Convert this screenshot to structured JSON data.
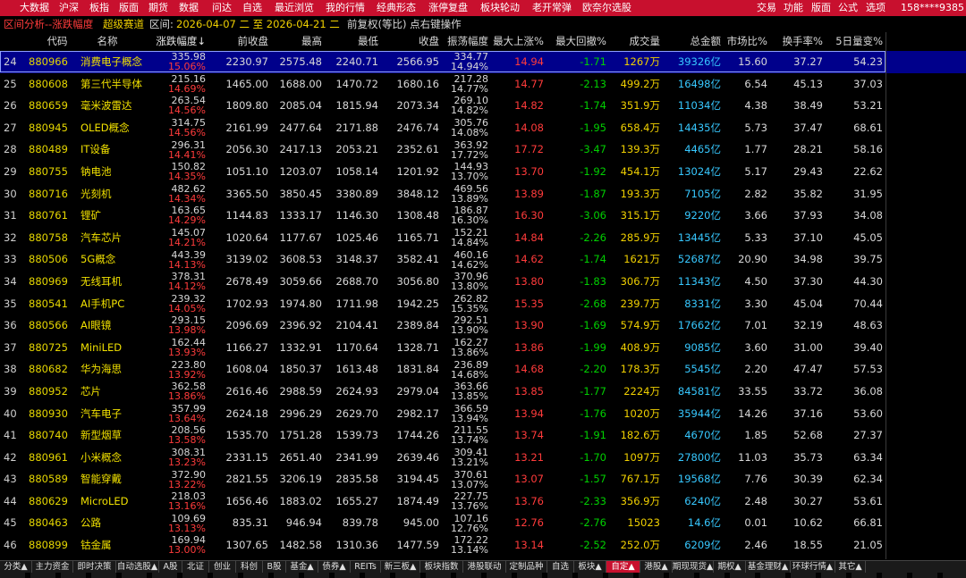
{
  "menubar": {
    "left": [
      "大数据",
      "沪深",
      "板指",
      "版面",
      "期货",
      "数据",
      "问达",
      "自选",
      "最近浏览",
      "我的行情",
      "经典形态",
      "涨停复盘",
      "板块轮动",
      "老开常弹",
      "欧奈尔选股"
    ],
    "right": [
      "交易",
      "功能",
      "版面",
      "公式",
      "选项"
    ],
    "account": "158****9385"
  },
  "infobar": {
    "title": "区间分析--涨跌幅度",
    "track": "超级赛道",
    "range_label": "区间:",
    "range": "2026-04-07 二 至 2026-04-21 二",
    "mode": "前复权(等比) 点右键操作"
  },
  "columns": [
    "代码",
    "名称",
    "涨跌幅度↓",
    "前收盘",
    "最高",
    "最低",
    "收盘",
    "振荡幅度",
    "最大上涨%",
    "最大回撤%",
    "成交量",
    "总金额",
    "市场比%",
    "换手率%",
    "5日量变%"
  ],
  "rows": [
    {
      "idx": "24",
      "code": "880966",
      "name": "消费电子概念",
      "chg": "335.98",
      "chg_pct": "15.06%",
      "prev": "2230.97",
      "high": "2575.48",
      "low": "2240.71",
      "close": "2566.95",
      "amp": "334.77",
      "amp_pct": "14.94%",
      "maxup": "14.94",
      "maxdd": "-1.71",
      "vol": "1267万",
      "amt": "39326亿",
      "mkt": "15.60",
      "turn": "37.27",
      "v5": "54.23"
    },
    {
      "idx": "25",
      "code": "880608",
      "name": "第三代半导体",
      "chg": "215.16",
      "chg_pct": "14.69%",
      "prev": "1465.00",
      "high": "1688.00",
      "low": "1470.72",
      "close": "1680.16",
      "amp": "217.28",
      "amp_pct": "14.77%",
      "maxup": "14.77",
      "maxdd": "-2.13",
      "vol": "499.2万",
      "amt": "16498亿",
      "mkt": "6.54",
      "turn": "45.13",
      "v5": "37.03"
    },
    {
      "idx": "26",
      "code": "880659",
      "name": "毫米波雷达",
      "chg": "263.54",
      "chg_pct": "14.56%",
      "prev": "1809.80",
      "high": "2085.04",
      "low": "1815.94",
      "close": "2073.34",
      "amp": "269.10",
      "amp_pct": "14.82%",
      "maxup": "14.82",
      "maxdd": "-1.74",
      "vol": "351.9万",
      "amt": "11034亿",
      "mkt": "4.38",
      "turn": "38.49",
      "v5": "53.21"
    },
    {
      "idx": "27",
      "code": "880945",
      "name": "OLED概念",
      "chg": "314.75",
      "chg_pct": "14.56%",
      "prev": "2161.99",
      "high": "2477.64",
      "low": "2171.88",
      "close": "2476.74",
      "amp": "305.76",
      "amp_pct": "14.08%",
      "maxup": "14.08",
      "maxdd": "-1.95",
      "vol": "658.4万",
      "amt": "14435亿",
      "mkt": "5.73",
      "turn": "37.47",
      "v5": "68.61"
    },
    {
      "idx": "28",
      "code": "880489",
      "name": "IT设备",
      "chg": "296.31",
      "chg_pct": "14.41%",
      "prev": "2056.30",
      "high": "2417.13",
      "low": "2053.21",
      "close": "2352.61",
      "amp": "363.92",
      "amp_pct": "17.72%",
      "maxup": "17.72",
      "maxdd": "-3.47",
      "vol": "139.3万",
      "amt": "4465亿",
      "mkt": "1.77",
      "turn": "28.21",
      "v5": "58.16"
    },
    {
      "idx": "29",
      "code": "880755",
      "name": "钠电池",
      "chg": "150.82",
      "chg_pct": "14.35%",
      "prev": "1051.10",
      "high": "1203.07",
      "low": "1058.14",
      "close": "1201.92",
      "amp": "144.93",
      "amp_pct": "13.70%",
      "maxup": "13.70",
      "maxdd": "-1.92",
      "vol": "454.1万",
      "amt": "13024亿",
      "mkt": "5.17",
      "turn": "29.43",
      "v5": "22.62"
    },
    {
      "idx": "30",
      "code": "880716",
      "name": "光刻机",
      "chg": "482.62",
      "chg_pct": "14.34%",
      "prev": "3365.50",
      "high": "3850.45",
      "low": "3380.89",
      "close": "3848.12",
      "amp": "469.56",
      "amp_pct": "13.89%",
      "maxup": "13.89",
      "maxdd": "-1.87",
      "vol": "193.3万",
      "amt": "7105亿",
      "mkt": "2.82",
      "turn": "35.82",
      "v5": "31.95"
    },
    {
      "idx": "31",
      "code": "880761",
      "name": "锂矿",
      "chg": "163.65",
      "chg_pct": "14.29%",
      "prev": "1144.83",
      "high": "1333.17",
      "low": "1146.30",
      "close": "1308.48",
      "amp": "186.87",
      "amp_pct": "16.30%",
      "maxup": "16.30",
      "maxdd": "-3.06",
      "vol": "315.1万",
      "amt": "9220亿",
      "mkt": "3.66",
      "turn": "37.93",
      "v5": "34.08"
    },
    {
      "idx": "32",
      "code": "880758",
      "name": "汽车芯片",
      "chg": "145.07",
      "chg_pct": "14.21%",
      "prev": "1020.64",
      "high": "1177.67",
      "low": "1025.46",
      "close": "1165.71",
      "amp": "152.21",
      "amp_pct": "14.84%",
      "maxup": "14.84",
      "maxdd": "-2.26",
      "vol": "285.9万",
      "amt": "13445亿",
      "mkt": "5.33",
      "turn": "37.10",
      "v5": "45.05"
    },
    {
      "idx": "33",
      "code": "880506",
      "name": "5G概念",
      "chg": "443.39",
      "chg_pct": "14.13%",
      "prev": "3139.02",
      "high": "3608.53",
      "low": "3148.37",
      "close": "3582.41",
      "amp": "460.16",
      "amp_pct": "14.62%",
      "maxup": "14.62",
      "maxdd": "-1.74",
      "vol": "1621万",
      "amt": "52687亿",
      "mkt": "20.90",
      "turn": "34.98",
      "v5": "39.75"
    },
    {
      "idx": "34",
      "code": "880969",
      "name": "无线耳机",
      "chg": "378.31",
      "chg_pct": "14.12%",
      "prev": "2678.49",
      "high": "3059.66",
      "low": "2688.70",
      "close": "3056.80",
      "amp": "370.96",
      "amp_pct": "13.80%",
      "maxup": "13.80",
      "maxdd": "-1.83",
      "vol": "306.7万",
      "amt": "11343亿",
      "mkt": "4.50",
      "turn": "37.30",
      "v5": "44.30"
    },
    {
      "idx": "35",
      "code": "880541",
      "name": "AI手机PC",
      "chg": "239.32",
      "chg_pct": "14.05%",
      "prev": "1702.93",
      "high": "1974.80",
      "low": "1711.98",
      "close": "1942.25",
      "amp": "262.82",
      "amp_pct": "15.35%",
      "maxup": "15.35",
      "maxdd": "-2.68",
      "vol": "239.7万",
      "amt": "8331亿",
      "mkt": "3.30",
      "turn": "45.04",
      "v5": "70.44"
    },
    {
      "idx": "36",
      "code": "880566",
      "name": "AI眼镜",
      "chg": "293.15",
      "chg_pct": "13.98%",
      "prev": "2096.69",
      "high": "2396.92",
      "low": "2104.41",
      "close": "2389.84",
      "amp": "292.51",
      "amp_pct": "13.90%",
      "maxup": "13.90",
      "maxdd": "-1.69",
      "vol": "574.9万",
      "amt": "17662亿",
      "mkt": "7.01",
      "turn": "32.19",
      "v5": "48.63"
    },
    {
      "idx": "37",
      "code": "880725",
      "name": "MiniLED",
      "chg": "162.44",
      "chg_pct": "13.93%",
      "prev": "1166.27",
      "high": "1332.91",
      "low": "1170.64",
      "close": "1328.71",
      "amp": "162.27",
      "amp_pct": "13.86%",
      "maxup": "13.86",
      "maxdd": "-1.99",
      "vol": "408.9万",
      "amt": "9085亿",
      "mkt": "3.60",
      "turn": "31.00",
      "v5": "39.40"
    },
    {
      "idx": "38",
      "code": "880682",
      "name": "华为海思",
      "chg": "223.80",
      "chg_pct": "13.92%",
      "prev": "1608.04",
      "high": "1850.37",
      "low": "1613.48",
      "close": "1831.84",
      "amp": "236.89",
      "amp_pct": "14.68%",
      "maxup": "14.68",
      "maxdd": "-2.20",
      "vol": "178.3万",
      "amt": "5545亿",
      "mkt": "2.20",
      "turn": "47.47",
      "v5": "57.53"
    },
    {
      "idx": "39",
      "code": "880952",
      "name": "芯片",
      "chg": "362.58",
      "chg_pct": "13.86%",
      "prev": "2616.46",
      "high": "2988.59",
      "low": "2624.93",
      "close": "2979.04",
      "amp": "363.66",
      "amp_pct": "13.85%",
      "maxup": "13.85",
      "maxdd": "-1.77",
      "vol": "2224万",
      "amt": "84581亿",
      "mkt": "33.55",
      "turn": "33.72",
      "v5": "36.08"
    },
    {
      "idx": "40",
      "code": "880930",
      "name": "汽车电子",
      "chg": "357.99",
      "chg_pct": "13.64%",
      "prev": "2624.18",
      "high": "2996.29",
      "low": "2629.70",
      "close": "2982.17",
      "amp": "366.59",
      "amp_pct": "13.94%",
      "maxup": "13.94",
      "maxdd": "-1.76",
      "vol": "1020万",
      "amt": "35944亿",
      "mkt": "14.26",
      "turn": "37.16",
      "v5": "53.60"
    },
    {
      "idx": "41",
      "code": "880740",
      "name": "新型烟草",
      "chg": "208.56",
      "chg_pct": "13.58%",
      "prev": "1535.70",
      "high": "1751.28",
      "low": "1539.73",
      "close": "1744.26",
      "amp": "211.55",
      "amp_pct": "13.74%",
      "maxup": "13.74",
      "maxdd": "-1.91",
      "vol": "182.6万",
      "amt": "4670亿",
      "mkt": "1.85",
      "turn": "52.68",
      "v5": "27.37"
    },
    {
      "idx": "42",
      "code": "880961",
      "name": "小米概念",
      "chg": "308.31",
      "chg_pct": "13.23%",
      "prev": "2331.15",
      "high": "2651.40",
      "low": "2341.99",
      "close": "2639.46",
      "amp": "309.41",
      "amp_pct": "13.21%",
      "maxup": "13.21",
      "maxdd": "-1.70",
      "vol": "1097万",
      "amt": "27800亿",
      "mkt": "11.03",
      "turn": "35.73",
      "v5": "63.34"
    },
    {
      "idx": "43",
      "code": "880589",
      "name": "智能穿戴",
      "chg": "372.90",
      "chg_pct": "13.22%",
      "prev": "2821.55",
      "high": "3206.19",
      "low": "2835.58",
      "close": "3194.45",
      "amp": "370.61",
      "amp_pct": "13.07%",
      "maxup": "13.07",
      "maxdd": "-1.57",
      "vol": "767.1万",
      "amt": "19568亿",
      "mkt": "7.76",
      "turn": "30.39",
      "v5": "62.34"
    },
    {
      "idx": "44",
      "code": "880629",
      "name": "MicroLED",
      "chg": "218.03",
      "chg_pct": "13.16%",
      "prev": "1656.46",
      "high": "1883.02",
      "low": "1655.27",
      "close": "1874.49",
      "amp": "227.75",
      "amp_pct": "13.76%",
      "maxup": "13.76",
      "maxdd": "-2.33",
      "vol": "356.9万",
      "amt": "6240亿",
      "mkt": "2.48",
      "turn": "30.27",
      "v5": "53.61"
    },
    {
      "idx": "45",
      "code": "880463",
      "name": "公路",
      "chg": "109.69",
      "chg_pct": "13.13%",
      "prev": "835.31",
      "high": "946.94",
      "low": "839.78",
      "close": "945.00",
      "amp": "107.16",
      "amp_pct": "12.76%",
      "maxup": "12.76",
      "maxdd": "-2.76",
      "vol": "15023",
      "amt": "14.6亿",
      "mkt": "0.01",
      "turn": "10.62",
      "v5": "66.81"
    },
    {
      "idx": "46",
      "code": "880899",
      "name": "钴金属",
      "chg": "169.94",
      "chg_pct": "13.00%",
      "prev": "1307.65",
      "high": "1482.58",
      "low": "1310.36",
      "close": "1477.59",
      "amp": "172.22",
      "amp_pct": "13.14%",
      "maxup": "13.14",
      "maxdd": "-2.52",
      "vol": "252.0万",
      "amt": "6209亿",
      "mkt": "2.46",
      "turn": "18.55",
      "v5": "21.05"
    }
  ],
  "tabs": [
    "分类▲",
    "主力资金",
    "即时决策",
    "自动选股▲",
    "A股",
    "北证",
    "创业",
    "科创",
    "B股",
    "基金▲",
    "债券▲",
    "REITs",
    "新三板▲",
    "板块指数",
    "港股联动",
    "定制品种",
    "自选",
    "板块▲",
    "自定▲",
    "港股▲",
    "期现现货▲",
    "期权▲",
    "基金理财▲",
    "环球行情▲",
    "其它▲"
  ],
  "active_tab": "自定▲",
  "colors": {
    "menu_bg": "#c8102e",
    "up": "#ff3b3b",
    "down": "#00d000",
    "code": "#e6d700",
    "name": "#f0e000",
    "amount": "#37c8ff",
    "select": "#00008b"
  }
}
